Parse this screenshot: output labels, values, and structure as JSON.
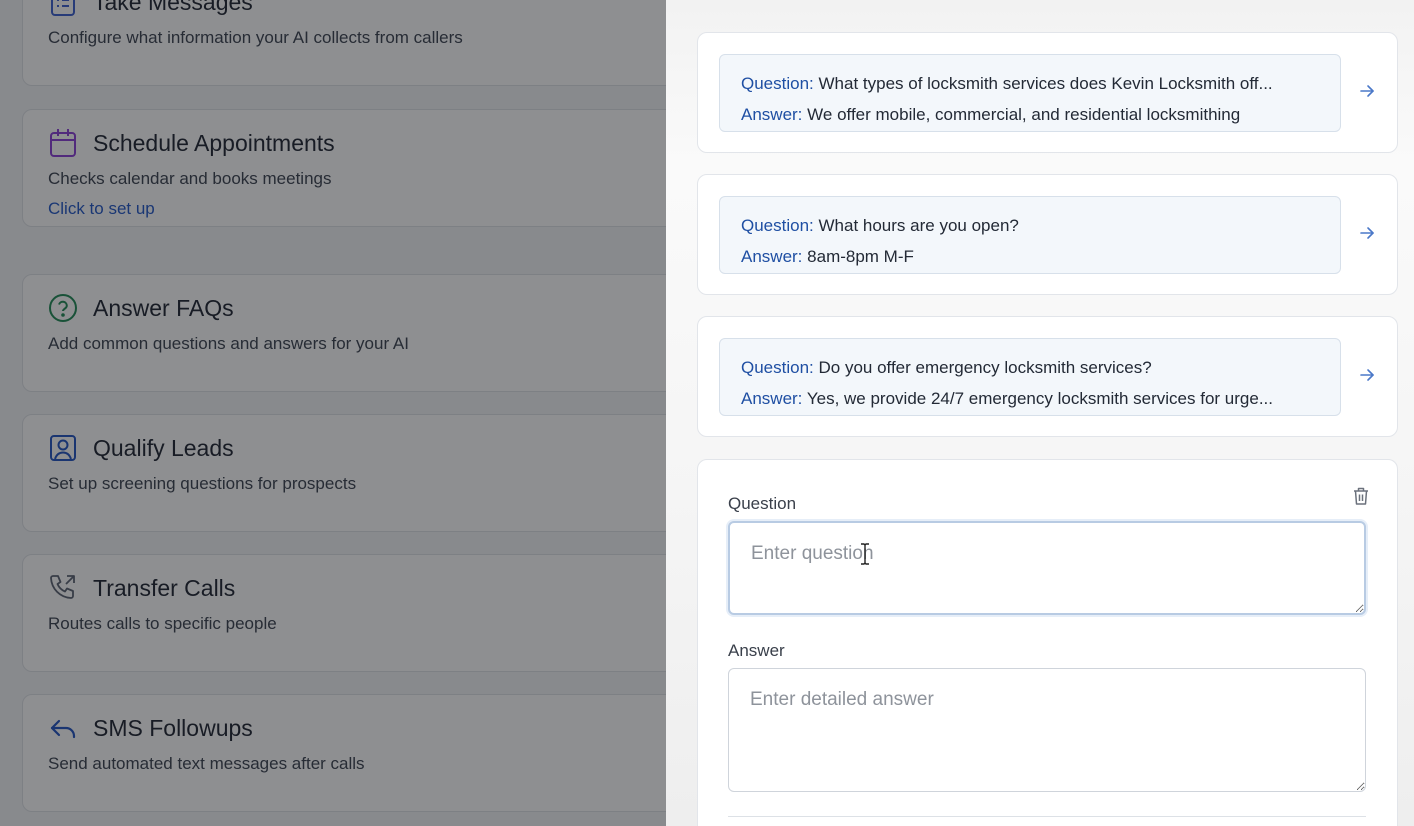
{
  "features": [
    {
      "title": "Take Messages",
      "description": "Configure what information your AI collects from callers",
      "link": "",
      "icon": "clipboard-list-icon",
      "icon_color": "#3a5fd0"
    },
    {
      "title": "Schedule Appointments",
      "description": "Checks calendar and books meetings",
      "link": "Click to set up",
      "icon": "calendar-icon",
      "icon_color": "#8a3fd6"
    },
    {
      "title": "Answer FAQs",
      "description": "Add common questions and answers for your AI",
      "link": "",
      "icon": "help-circle-icon",
      "icon_color": "#1f8a55"
    },
    {
      "title": "Qualify Leads",
      "description": "Set up screening questions for prospects",
      "link": "",
      "icon": "user-square-icon",
      "icon_color": "#2254c2"
    },
    {
      "title": "Transfer Calls",
      "description": "Routes calls to specific people",
      "link": "",
      "icon": "phone-forward-icon",
      "icon_color": "#5a6272"
    },
    {
      "title": "SMS Followups",
      "description": "Send automated text messages after calls",
      "link": "",
      "icon": "reply-arrow-icon",
      "icon_color": "#2254c2"
    }
  ],
  "faq": {
    "question_prefix": "Question:",
    "answer_prefix": "Answer:",
    "items": [
      {
        "question": "What types of locksmith services does Kevin Locksmith off...",
        "answer": "We offer mobile, commercial, and residential locksmithing"
      },
      {
        "question": "What hours are you open?",
        "answer": "8am-8pm M-F"
      },
      {
        "question": "Do you offer emergency locksmith services?",
        "answer": "Yes, we provide 24/7 emergency locksmith services for urge..."
      }
    ],
    "arrow_icon": "arrow-right-icon"
  },
  "form": {
    "question_label": "Question",
    "question_placeholder": "Enter question",
    "answer_label": "Answer",
    "answer_placeholder": "Enter detailed answer",
    "delete_icon": "trash-icon"
  },
  "colors": {
    "accent": "#1f4fa3",
    "link": "#2257c8",
    "faq_box_bg": "#f3f7fb",
    "focus_border": "#b8cbe3"
  }
}
